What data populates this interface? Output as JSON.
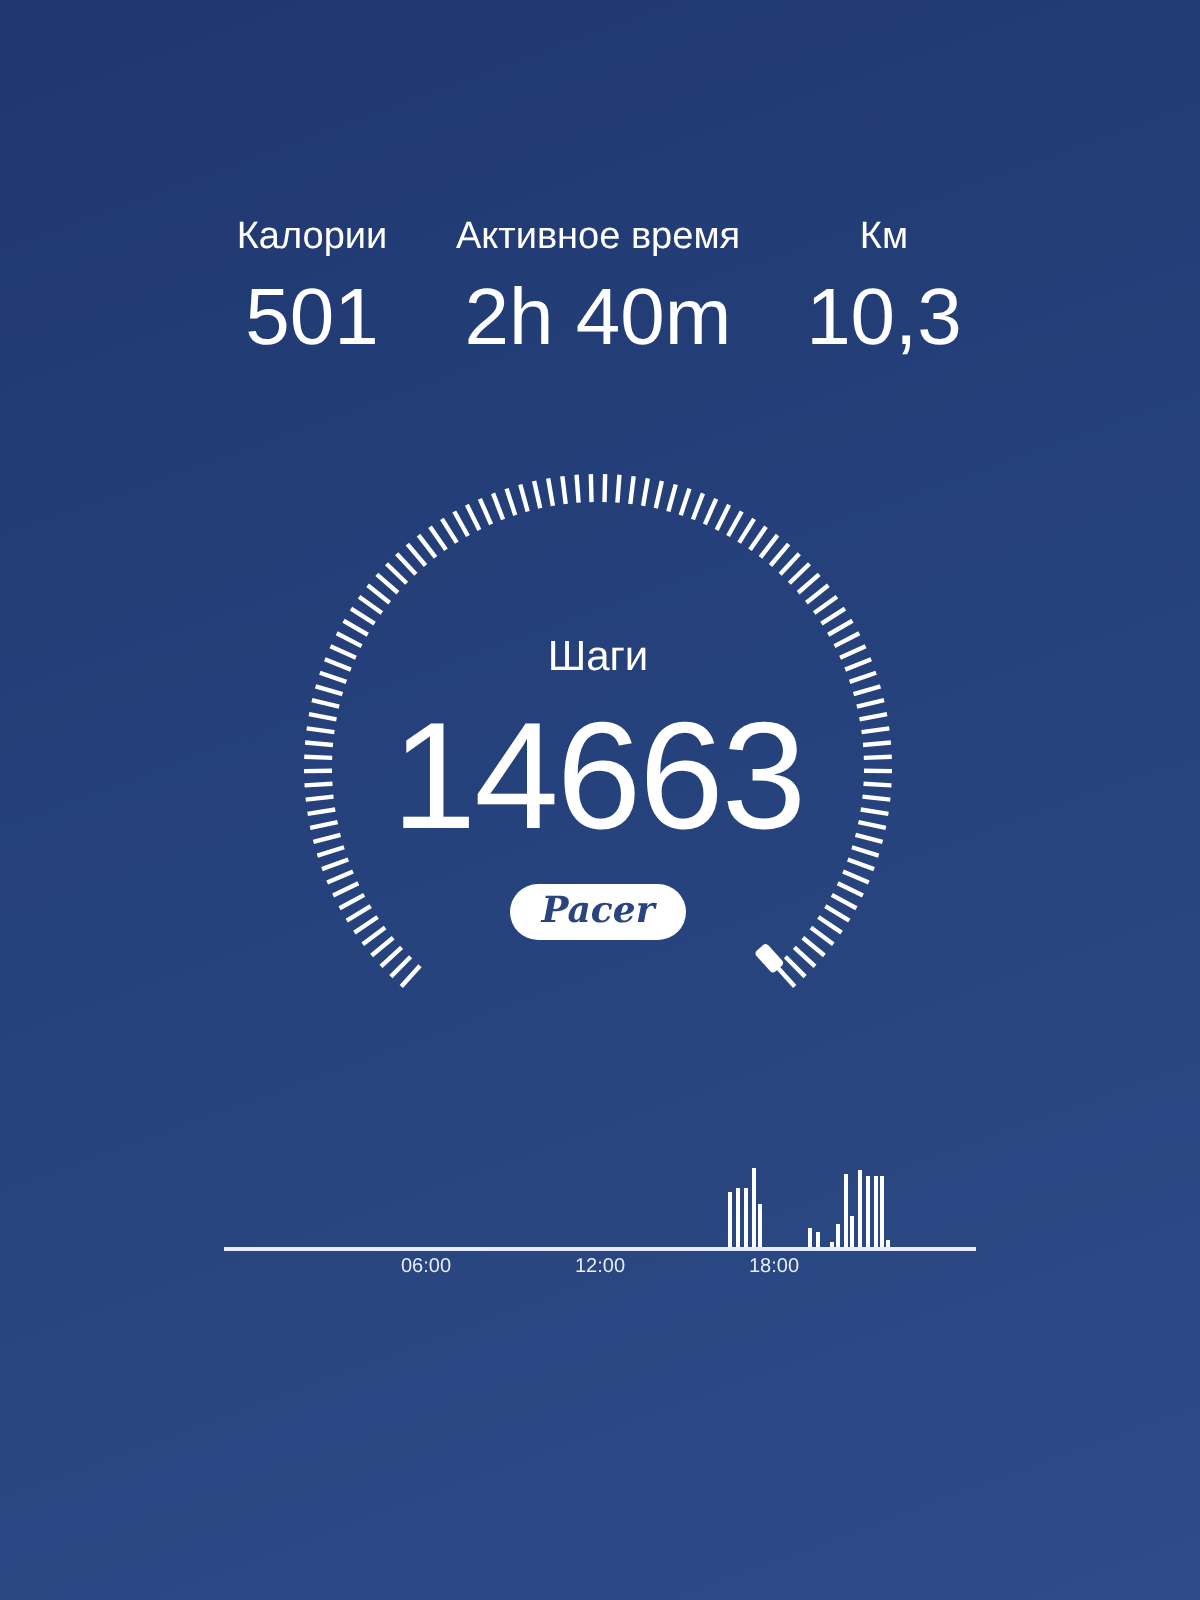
{
  "stats": [
    {
      "label": "Калории",
      "value": "501"
    },
    {
      "label": "Активное время",
      "value": "2h 40m"
    },
    {
      "label": "Км",
      "value": "10,3"
    }
  ],
  "steps": {
    "label": "Шаги",
    "value": "14663",
    "logo": "Pacer"
  },
  "activity": {
    "tick_labels": [
      "06:00",
      "12:00",
      "18:00"
    ]
  }
}
